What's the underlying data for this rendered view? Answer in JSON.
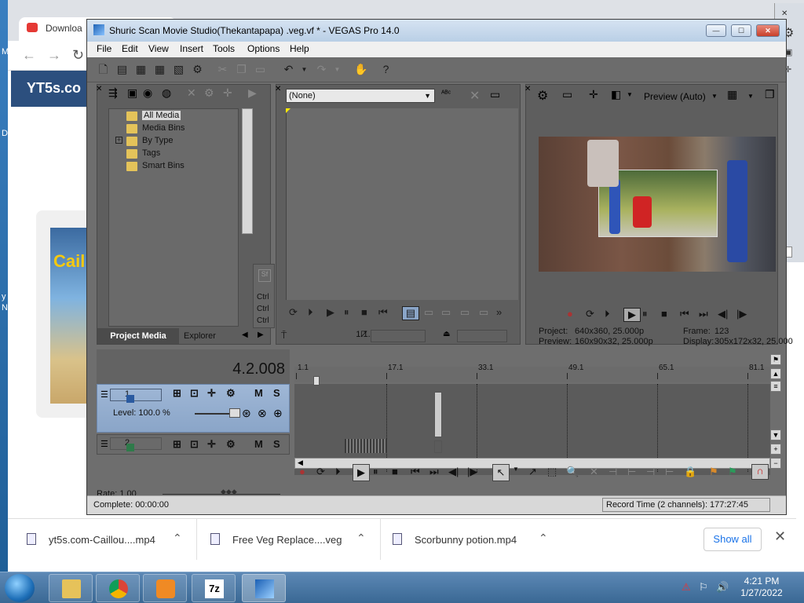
{
  "chrome": {
    "tab_label": "Downloa",
    "site_logo": "YT5s.co",
    "thumb_text": "Cail"
  },
  "desktop_letters": [
    "M",
    "D",
    "y",
    "N"
  ],
  "vegas": {
    "title": "Shuric Scan Movie Studio(Thekantapapa) .veg.vf * - VEGAS Pro 14.0",
    "menu": [
      "File",
      "Edit",
      "View",
      "Insert",
      "Tools",
      "Options",
      "Help"
    ],
    "media": {
      "tree": [
        "All Media",
        "Media Bins",
        "By Type",
        "Tags",
        "Smart Bins"
      ],
      "tab_project": "Project Media",
      "tab_explorer": "Explorer",
      "side_ctrl": [
        "Ctrl",
        "Ctrl",
        "Ctrl"
      ]
    },
    "trimmer": {
      "select_value": "(None)",
      "time": "1.1.000"
    },
    "preview": {
      "mode_label": "Preview (Auto)",
      "project_label": "Project:",
      "project_value": "640x360, 25.000p",
      "frame_label": "Frame:",
      "frame_value": "123",
      "preview_label": "Preview:",
      "preview_value": "160x90x32, 25.000p",
      "display_label": "Display:",
      "display_value": "305x172x32, 25.000"
    },
    "timeline": {
      "time_code": "4.2.008",
      "ruler_ticks": [
        "1.1",
        "17.1",
        "33.1",
        "49.1",
        "65.1",
        "81.1"
      ],
      "track1_num": "1",
      "track2_num": "2",
      "track_m": "M",
      "track_s": "S",
      "level_label": "Level: 100.0 %",
      "rate_label": "Rate: 1.00"
    },
    "status": {
      "left": "Complete: 00:00:00",
      "right": "Record Time (2 channels): 177:27:45"
    }
  },
  "downloads": {
    "items": [
      "yt5s.com-Caillou....mp4",
      "Free Veg Replace....veg",
      "Scorbunny potion.mp4"
    ],
    "show_all": "Show all"
  },
  "taskbar": {
    "time": "4:21 PM",
    "date": "1/27/2022",
    "apps": [
      "file-explorer-icon",
      "chrome-icon",
      "media-player-icon",
      "7zip-icon",
      "vegas-icon"
    ],
    "app_7z_label": "7z"
  },
  "colors": {
    "vegas_bg": "#6e6e6e",
    "track_blue": "#9fb7d6",
    "chrome_accent": "#1a73e8"
  }
}
